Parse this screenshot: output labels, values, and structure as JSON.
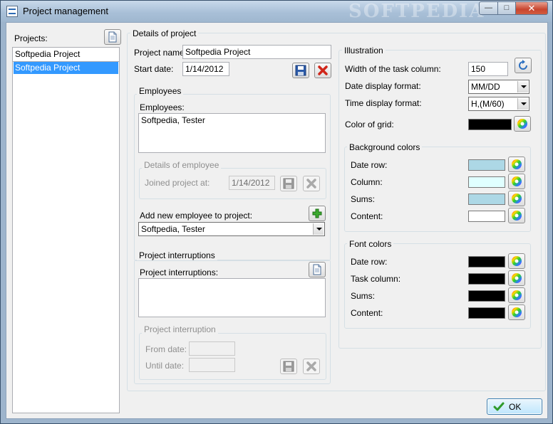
{
  "window": {
    "title": "Project management",
    "watermark": "SOFTPEDIA"
  },
  "projects": {
    "label": "Projects:",
    "input_value": "Softpedia Project",
    "items": [
      "Softpedia Project"
    ]
  },
  "details": {
    "title": "Details of project",
    "project_name_label": "Project name:",
    "project_name_value": "Softpedia Project",
    "start_date_label": "Start date:",
    "start_date_value": "1/14/2012"
  },
  "employees": {
    "group_title": "Employees",
    "list_label": "Employees:",
    "list_value": "Softpedia, Tester",
    "details_title": "Details of employee",
    "joined_label": "Joined project at:",
    "joined_value": "1/14/2012",
    "add_label": "Add new employee to project:",
    "add_selected": "Softpedia, Tester"
  },
  "interruptions": {
    "group_title": "Project interruptions",
    "list_label": "Project interruptions:",
    "details_title": "Project interruption",
    "from_label": "From date:",
    "until_label": "Until date:"
  },
  "illustration": {
    "title": "Illustration",
    "width_label": "Width of the task column:",
    "width_value": "150",
    "date_format_label": "Date display format:",
    "date_format_value": "MM/DD",
    "time_format_label": "Time display format:",
    "time_format_value": "H,(M/60)",
    "grid_color_label": "Color of grid:",
    "grid_color": "#000000"
  },
  "background_colors": {
    "title": "Background colors",
    "rows": [
      {
        "label": "Date row:",
        "color": "#add8e6"
      },
      {
        "label": "Column:",
        "color": "#e0ffff"
      },
      {
        "label": "Sums:",
        "color": "#add8e6"
      },
      {
        "label": "Content:",
        "color": "#ffffff"
      }
    ]
  },
  "font_colors": {
    "title": "Font colors",
    "rows": [
      {
        "label": "Date row:",
        "color": "#000000"
      },
      {
        "label": "Task column:",
        "color": "#000000"
      },
      {
        "label": "Sums:",
        "color": "#000000"
      },
      {
        "label": "Content:",
        "color": "#000000"
      }
    ]
  },
  "footer": {
    "ok_label": "OK"
  },
  "icons": {
    "new": "new-document-icon",
    "save": "floppy-save-icon",
    "delete": "red-x-delete-icon",
    "add": "green-plus-icon",
    "refresh": "refresh-icon",
    "color": "color-wheel-icon",
    "ok": "green-check-icon"
  }
}
